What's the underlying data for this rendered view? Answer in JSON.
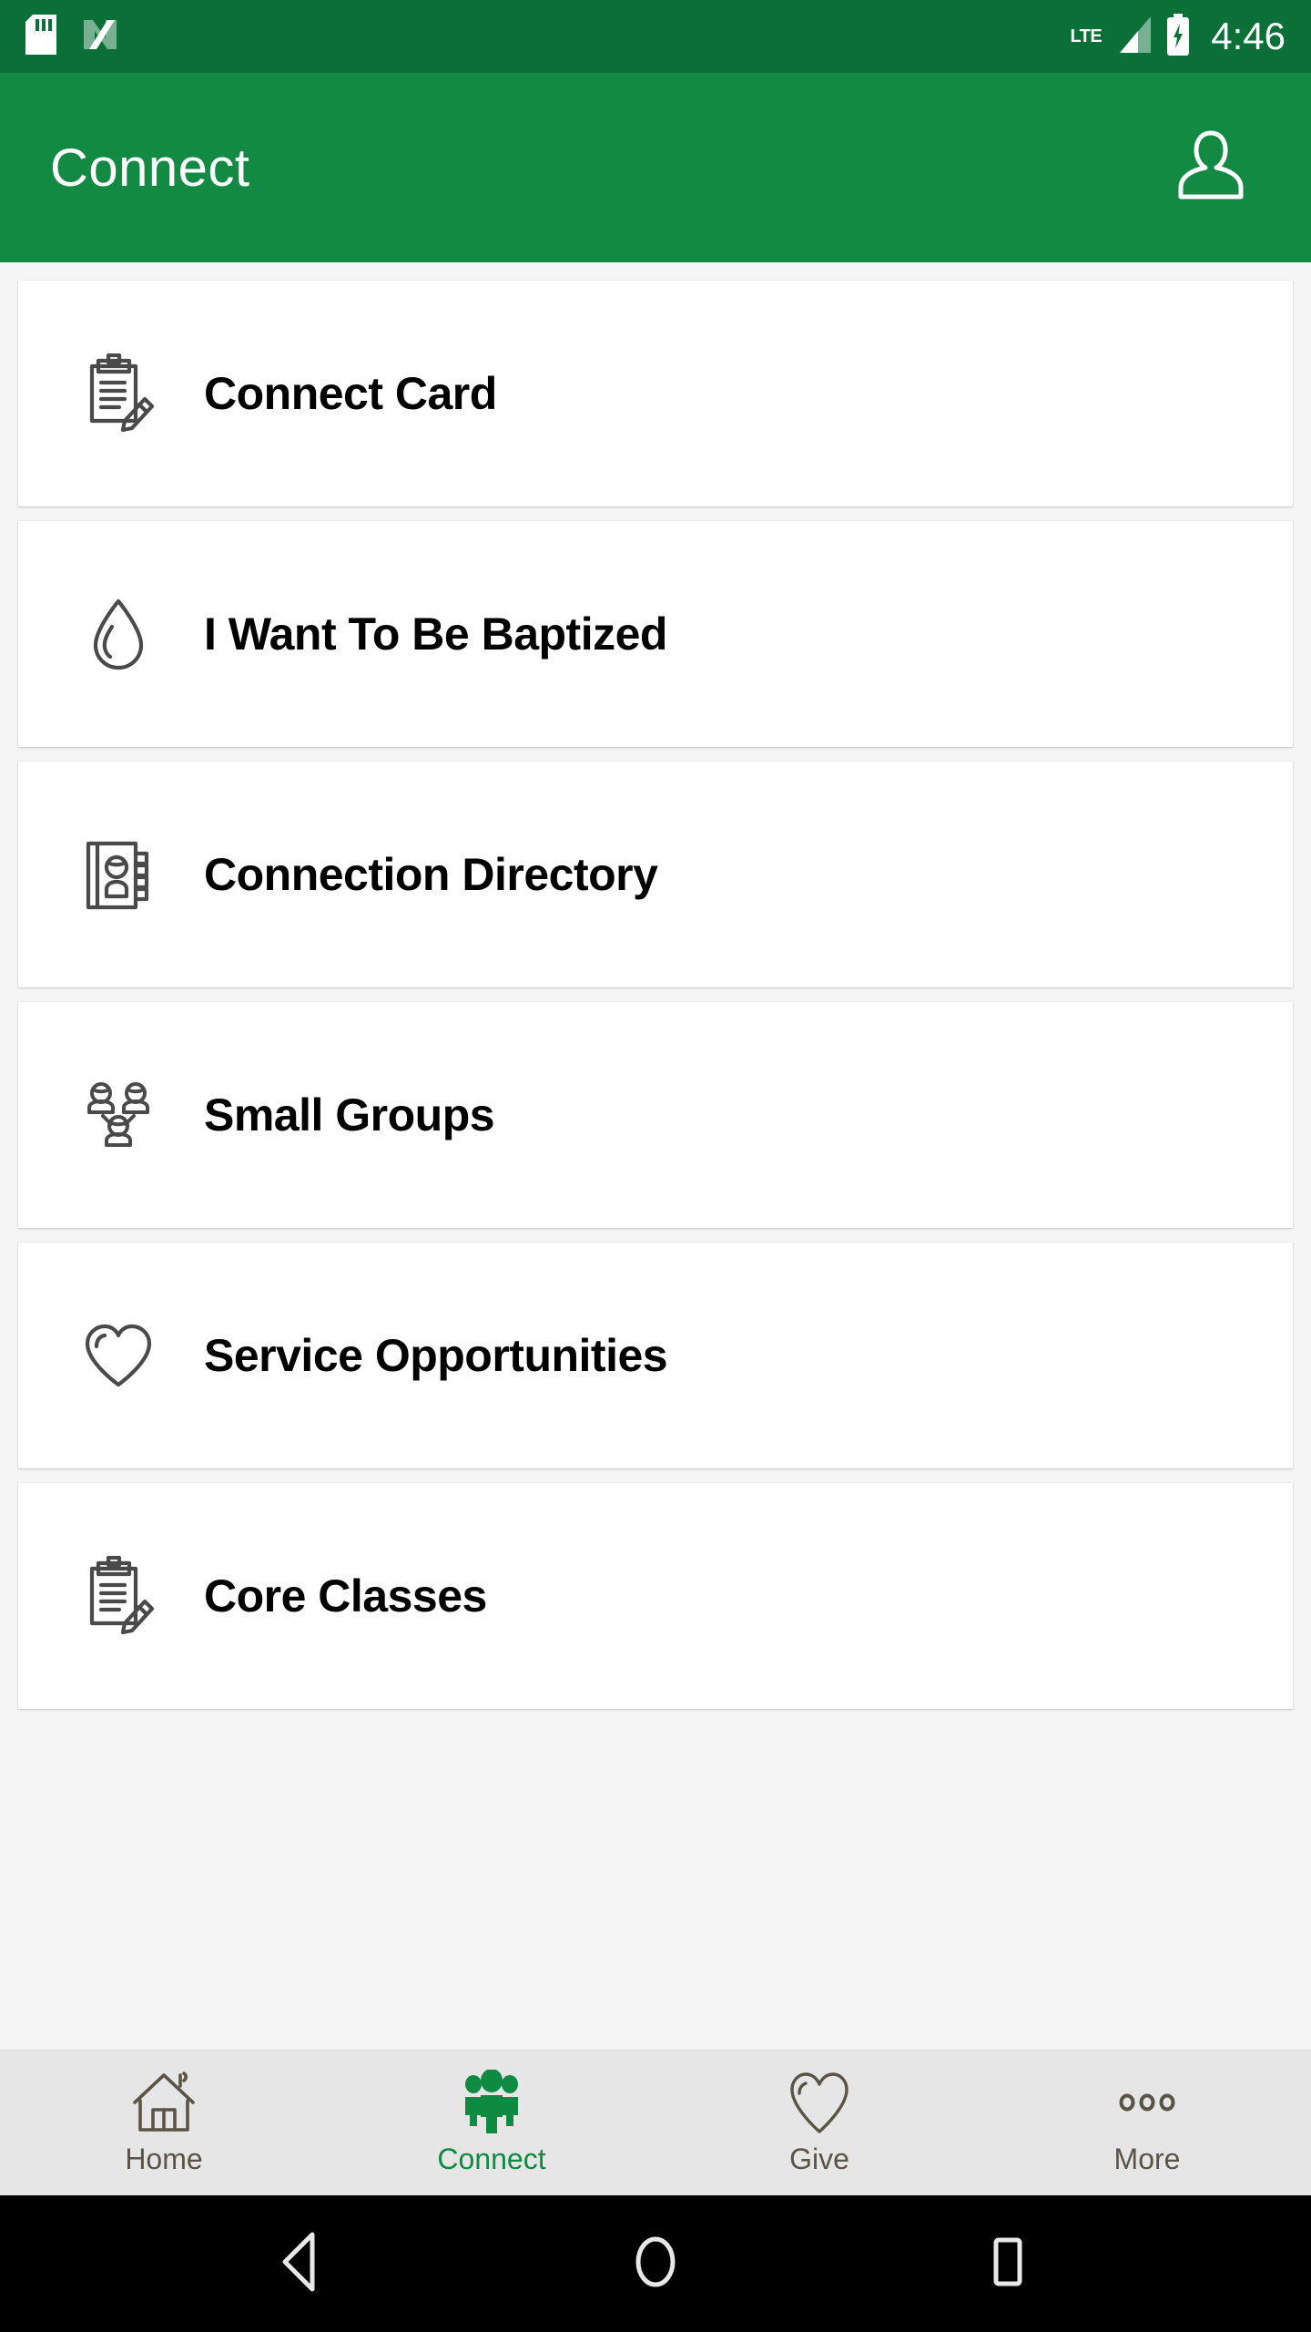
{
  "status_bar": {
    "background_color": "#0b7037",
    "icons": [
      "sd-card-icon",
      "android-nougat-icon"
    ],
    "network_label": "LTE",
    "signal_icon": "signal-bars-icon",
    "battery_icon": "battery-charging-icon",
    "time": "4:46"
  },
  "app_bar": {
    "background_color": "#138a43",
    "title": "Connect",
    "profile_icon": "person-outline-icon"
  },
  "main": {
    "background_color": "#f5f5f5",
    "cards": [
      {
        "label": "Connect Card",
        "icon": "clipboard-pencil-icon"
      },
      {
        "label": "I Want To Be Baptized",
        "icon": "water-drop-icon"
      },
      {
        "label": "Connection Directory",
        "icon": "address-book-person-icon"
      },
      {
        "label": "Small Groups",
        "icon": "three-people-group-icon"
      },
      {
        "label": "Service Opportunities",
        "icon": "heart-outline-icon"
      },
      {
        "label": "Core Classes",
        "icon": "clipboard-pencil-icon"
      }
    ]
  },
  "tab_bar": {
    "background_color": "#e6e6e6",
    "inactive_color": "#5a5446",
    "active_color": "#0e8a42",
    "active_index": 1,
    "tabs": [
      {
        "label": "Home",
        "icon": "house-icon"
      },
      {
        "label": "Connect",
        "icon": "people-group-filled-icon"
      },
      {
        "label": "Give",
        "icon": "heart-outline-icon"
      },
      {
        "label": "More",
        "icon": "three-dots-icon"
      }
    ]
  },
  "android_nav": {
    "background_color": "#000000",
    "buttons": [
      {
        "icon": "back-triangle-icon"
      },
      {
        "icon": "home-circle-icon"
      },
      {
        "icon": "recents-square-icon"
      }
    ]
  }
}
